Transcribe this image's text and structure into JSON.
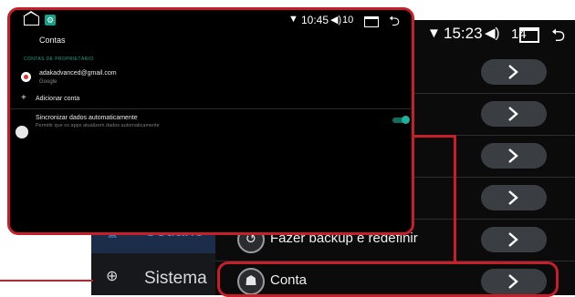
{
  "background_screen": {
    "status_bar": {
      "wifi_icon": "wifi-icon",
      "time": "15:23",
      "volume_icon": "volume-icon",
      "volume_level": "14",
      "recents_icon": "recents-icon",
      "back_icon": "back-icon"
    },
    "sidebar": {
      "items": [
        {
          "label": "Usuário",
          "icon": "user-icon"
        },
        {
          "label": "Sistema",
          "icon": "globe-icon"
        }
      ]
    },
    "settings_list": [
      {
        "label": "",
        "icon": ""
      },
      {
        "label": "",
        "icon": ""
      },
      {
        "label": "",
        "icon": ""
      },
      {
        "label": "",
        "icon": ""
      },
      {
        "label": "Fazer backup e redefinir",
        "icon": "backup-restore-icon"
      },
      {
        "label": "Conta",
        "icon": "android-icon"
      }
    ]
  },
  "popup": {
    "status_bar": {
      "time": "10:45",
      "volume_level": "10"
    },
    "title": "Contas",
    "section_header": "CONTAS DE PROPRIETÁRIO",
    "account": {
      "email": "adakadvanced@gmail.com",
      "type": "Google"
    },
    "add_account_label": "Adicionar conta",
    "sync": {
      "title": "Sincronizar dados automaticamente",
      "subtitle": "Permitir que os apps atualizem dados automaticamente",
      "enabled": true
    }
  },
  "colors": {
    "callout_red": "#c81e2a",
    "accent_teal": "#15a28b",
    "active_blue": "#4e93d6"
  }
}
